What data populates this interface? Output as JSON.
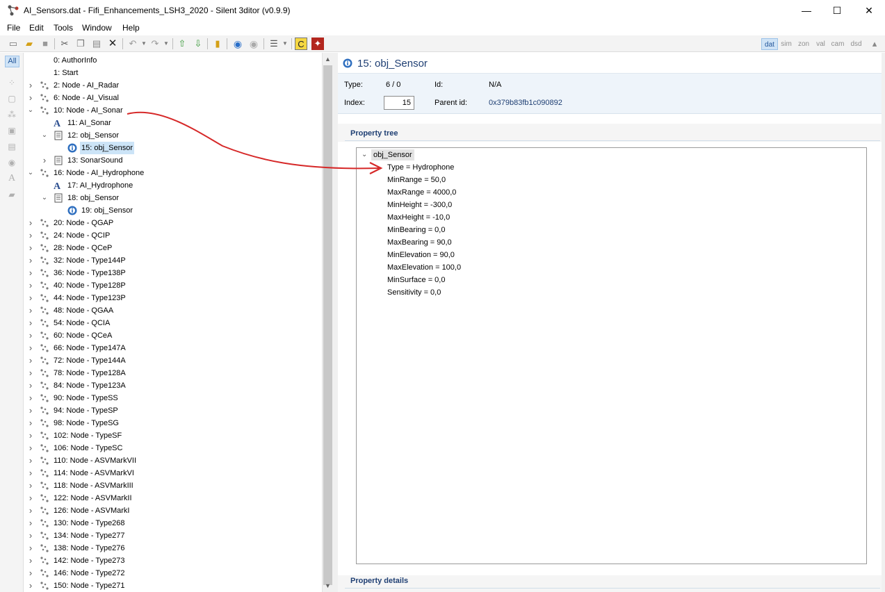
{
  "window": {
    "title": "AI_Sensors.dat - Fifi_Enhancements_LSH3_2020 - Silent 3ditor (v0.9.9)",
    "minimize": "—",
    "maximize": "☐",
    "close": "✕"
  },
  "menu": [
    "File",
    "Edit",
    "Tools",
    "Window",
    "Help"
  ],
  "toolbar": {
    "views": [
      "dat",
      "sim",
      "zon",
      "val",
      "cam",
      "dsd"
    ],
    "active_view": "dat"
  },
  "strip": {
    "all_label": "All"
  },
  "tree": [
    {
      "label": "0: AuthorInfo",
      "level": 0,
      "expander": "",
      "icon": "none"
    },
    {
      "label": "1: Start",
      "level": 0,
      "expander": "",
      "icon": "none"
    },
    {
      "label": "2: Node - AI_Radar",
      "level": 0,
      "expander": "collapsed",
      "icon": "node"
    },
    {
      "label": "6: Node - AI_Visual",
      "level": 0,
      "expander": "collapsed",
      "icon": "node"
    },
    {
      "label": "10: Node - AI_Sonar",
      "level": 0,
      "expander": "expanded",
      "icon": "node"
    },
    {
      "label": "11: AI_Sonar",
      "level": 1,
      "expander": "",
      "icon": "text"
    },
    {
      "label": "12: obj_Sensor",
      "level": 1,
      "expander": "expanded",
      "icon": "doc"
    },
    {
      "label": "15: obj_Sensor",
      "level": 2,
      "expander": "",
      "icon": "info",
      "selected": true
    },
    {
      "label": "13: SonarSound",
      "level": 1,
      "expander": "collapsed",
      "icon": "doc"
    },
    {
      "label": "16: Node - AI_Hydrophone",
      "level": 0,
      "expander": "expanded",
      "icon": "node"
    },
    {
      "label": "17: AI_Hydrophone",
      "level": 1,
      "expander": "",
      "icon": "text"
    },
    {
      "label": "18: obj_Sensor",
      "level": 1,
      "expander": "expanded",
      "icon": "doc"
    },
    {
      "label": "19: obj_Sensor",
      "level": 2,
      "expander": "",
      "icon": "info"
    },
    {
      "label": "20: Node - QGAP",
      "level": 0,
      "expander": "collapsed",
      "icon": "node"
    },
    {
      "label": "24: Node - QCIP",
      "level": 0,
      "expander": "collapsed",
      "icon": "node"
    },
    {
      "label": "28: Node - QCeP",
      "level": 0,
      "expander": "collapsed",
      "icon": "node"
    },
    {
      "label": "32: Node - Type144P",
      "level": 0,
      "expander": "collapsed",
      "icon": "node"
    },
    {
      "label": "36: Node - Type138P",
      "level": 0,
      "expander": "collapsed",
      "icon": "node"
    },
    {
      "label": "40: Node - Type128P",
      "level": 0,
      "expander": "collapsed",
      "icon": "node"
    },
    {
      "label": "44: Node - Type123P",
      "level": 0,
      "expander": "collapsed",
      "icon": "node"
    },
    {
      "label": "48: Node - QGAA",
      "level": 0,
      "expander": "collapsed",
      "icon": "node"
    },
    {
      "label": "54: Node - QCIA",
      "level": 0,
      "expander": "collapsed",
      "icon": "node"
    },
    {
      "label": "60: Node - QCeA",
      "level": 0,
      "expander": "collapsed",
      "icon": "node"
    },
    {
      "label": "66: Node - Type147A",
      "level": 0,
      "expander": "collapsed",
      "icon": "node"
    },
    {
      "label": "72: Node - Type144A",
      "level": 0,
      "expander": "collapsed",
      "icon": "node"
    },
    {
      "label": "78: Node - Type128A",
      "level": 0,
      "expander": "collapsed",
      "icon": "node"
    },
    {
      "label": "84: Node - Type123A",
      "level": 0,
      "expander": "collapsed",
      "icon": "node"
    },
    {
      "label": "90: Node - TypeSS",
      "level": 0,
      "expander": "collapsed",
      "icon": "node"
    },
    {
      "label": "94: Node - TypeSP",
      "level": 0,
      "expander": "collapsed",
      "icon": "node"
    },
    {
      "label": "98: Node - TypeSG",
      "level": 0,
      "expander": "collapsed",
      "icon": "node"
    },
    {
      "label": "102: Node - TypeSF",
      "level": 0,
      "expander": "collapsed",
      "icon": "node"
    },
    {
      "label": "106: Node - TypeSC",
      "level": 0,
      "expander": "collapsed",
      "icon": "node"
    },
    {
      "label": "110: Node - ASVMarkVII",
      "level": 0,
      "expander": "collapsed",
      "icon": "node"
    },
    {
      "label": "114: Node - ASVMarkVI",
      "level": 0,
      "expander": "collapsed",
      "icon": "node"
    },
    {
      "label": "118: Node - ASVMarkIII",
      "level": 0,
      "expander": "collapsed",
      "icon": "node"
    },
    {
      "label": "122: Node - ASVMarkII",
      "level": 0,
      "expander": "collapsed",
      "icon": "node"
    },
    {
      "label": "126: Node - ASVMarkI",
      "level": 0,
      "expander": "collapsed",
      "icon": "node"
    },
    {
      "label": "130: Node - Type268",
      "level": 0,
      "expander": "collapsed",
      "icon": "node"
    },
    {
      "label": "134: Node - Type277",
      "level": 0,
      "expander": "collapsed",
      "icon": "node"
    },
    {
      "label": "138: Node - Type276",
      "level": 0,
      "expander": "collapsed",
      "icon": "node"
    },
    {
      "label": "142: Node - Type273",
      "level": 0,
      "expander": "collapsed",
      "icon": "node"
    },
    {
      "label": "146: Node - Type272",
      "level": 0,
      "expander": "collapsed",
      "icon": "node"
    },
    {
      "label": "150: Node - Type271",
      "level": 0,
      "expander": "collapsed",
      "icon": "node"
    }
  ],
  "detail": {
    "title": "15: obj_Sensor",
    "type_label": "Type:",
    "type_value": "6 / 0",
    "id_label": "Id:",
    "id_value": "N/A",
    "index_label": "Index:",
    "index_value": "15",
    "parent_label": "Parent id:",
    "parent_value": "0x379b83fb1c090892",
    "property_tree_heading": "Property tree",
    "root": "obj_Sensor",
    "properties": [
      "Type = Hydrophone",
      "MinRange = 50,0",
      "MaxRange = 4000,0",
      "MinHeight = -300,0",
      "MaxHeight = -10,0",
      "MinBearing = 0,0",
      "MaxBearing = 90,0",
      "MinElevation = 90,0",
      "MaxElevation = 100,0",
      "MinSurface = 0,0",
      "Sensitivity = 0,0"
    ],
    "property_details_heading": "Property details"
  },
  "colors": {
    "accent": "#1f3f73",
    "selection": "#cce4f7",
    "arrow": "#d62828",
    "parent_id": "#1f3f73"
  }
}
